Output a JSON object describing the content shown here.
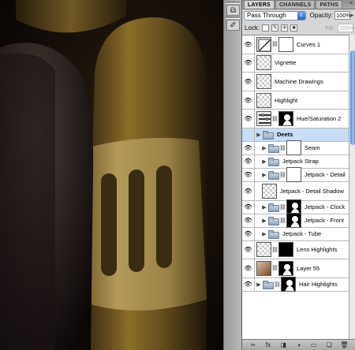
{
  "panel": {
    "tabs": [
      "LAYERS",
      "CHANNELS",
      "PATHS"
    ],
    "active_tab": "LAYERS",
    "blend_mode": "Pass Through",
    "opacity_label": "Opacity:",
    "opacity_value": "100%",
    "lock_label": "Lock:",
    "fill_label": "Fill:",
    "fill_value": "100%"
  },
  "layers": [
    {
      "name": "Curves 1",
      "kind": "adjustment",
      "thumb": "adj-curves",
      "mask": "mask",
      "group": false,
      "indent": 0
    },
    {
      "name": "Vignette",
      "kind": "pixel",
      "thumb": "transparent",
      "group": false,
      "indent": 0
    },
    {
      "name": "Machine Drawings",
      "kind": "pixel",
      "thumb": "transparent",
      "group": false,
      "indent": 0
    },
    {
      "name": "Highlight",
      "kind": "pixel",
      "thumb": "transparent",
      "group": false,
      "indent": 0
    },
    {
      "name": "Hue/Saturation 2",
      "kind": "adjustment",
      "thumb": "adj-hue",
      "mask": "black-figure",
      "group": false,
      "indent": 0
    },
    {
      "name": "Deets",
      "kind": "group",
      "group": true,
      "selected": true,
      "indent": 0
    },
    {
      "name": "Seam",
      "kind": "group-mask",
      "group": true,
      "mask": "mask",
      "indent": 1
    },
    {
      "name": "Jetpack Strap",
      "kind": "group",
      "group": true,
      "indent": 1
    },
    {
      "name": "Jetpack - Detail",
      "kind": "group-mask",
      "group": true,
      "mask": "mask",
      "indent": 1
    },
    {
      "name": "Jetpack - Detail Shadow",
      "kind": "pixel",
      "thumb": "transparent",
      "group": false,
      "indent": 1
    },
    {
      "name": "Jetpack - Clock",
      "kind": "group-mask",
      "group": true,
      "mask": "black-figure",
      "indent": 1
    },
    {
      "name": "Jetpack - Front",
      "kind": "group-mask",
      "group": true,
      "mask": "black-figure",
      "indent": 1
    },
    {
      "name": "Jetpack - Tube",
      "kind": "group",
      "group": true,
      "indent": 1
    },
    {
      "name": "Lens Highlights",
      "kind": "pixel-mask",
      "thumb": "transparent",
      "mask": "black",
      "group": false,
      "indent": 0
    },
    {
      "name": "Layer 55",
      "kind": "pixel-mask",
      "thumb": "face",
      "mask": "black-figure",
      "group": false,
      "indent": 0
    },
    {
      "name": "Hair Highlights",
      "kind": "group-mask",
      "group": true,
      "mask": "black-figure",
      "indent": 0
    }
  ],
  "bottom_bar": {
    "icons": [
      "link-icon",
      "fx-icon",
      "mask-icon",
      "adjustment-icon",
      "new-group-icon",
      "new-layer-icon",
      "trash-icon"
    ],
    "glyphs": [
      "∞",
      "fx",
      "◨",
      "◑",
      "▭",
      "❏",
      "🗑"
    ]
  },
  "toolstrip": {
    "icons": [
      "tool-preset-icon",
      "brush-icon"
    ],
    "glyphs": [
      "⧉",
      "✐"
    ]
  },
  "colors": {
    "panel_bg": "#d6d6d6",
    "selection": "#c7ddf6",
    "canvas_dark": "#0e0906",
    "brass": "#a98a35"
  }
}
